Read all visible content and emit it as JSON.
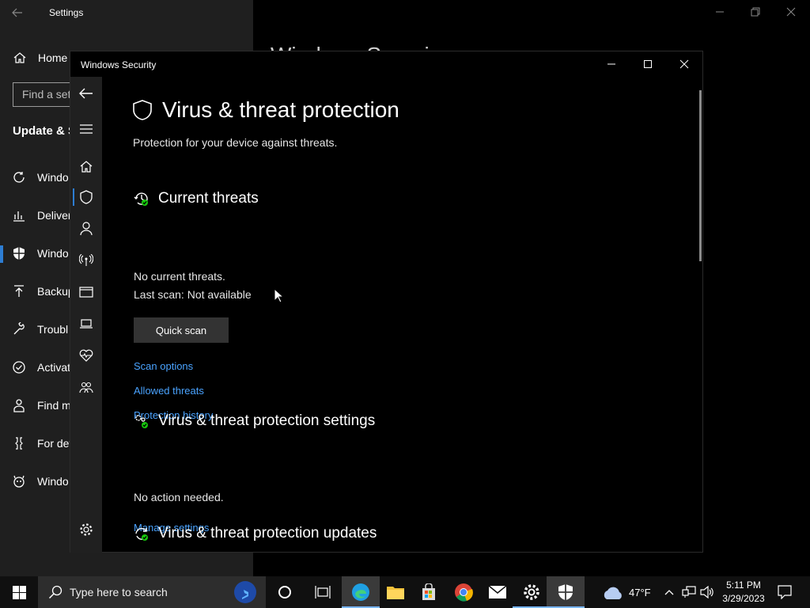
{
  "settings": {
    "title": "Settings",
    "home_label": "Home",
    "search_placeholder": "Find a set",
    "section_title": "Update & S",
    "bg_page_title": "Windows Securi",
    "items": [
      {
        "label": "Windo",
        "icon": "refresh-icon"
      },
      {
        "label": "Deliver",
        "icon": "delivery-icon"
      },
      {
        "label": "Windo",
        "icon": "shield-icon"
      },
      {
        "label": "Backup",
        "icon": "backup-icon"
      },
      {
        "label": "Troubl",
        "icon": "wrench-icon"
      },
      {
        "label": "Activat",
        "icon": "check-circle-icon"
      },
      {
        "label": "Find m",
        "icon": "person-icon"
      },
      {
        "label": "For dev",
        "icon": "developer-icon"
      },
      {
        "label": "Windo",
        "icon": "insider-icon"
      }
    ],
    "active_index": 2
  },
  "security": {
    "window_title": "Windows Security",
    "page_title": "Virus & threat protection",
    "page_subtitle": "Protection for your device against threats.",
    "current_threats": {
      "heading": "Current threats",
      "status": "No current threats.",
      "last_scan": "Last scan: Not available",
      "quick_scan_label": "Quick scan",
      "links": [
        "Scan options",
        "Allowed threats",
        "Protection history"
      ]
    },
    "settings_section": {
      "heading": "Virus & threat protection settings",
      "status": "No action needed.",
      "link": "Manage settings"
    },
    "updates_section": {
      "heading": "Virus & threat protection updates"
    }
  },
  "taskbar": {
    "search_placeholder": "Type here to search",
    "weather": "47°F",
    "time": "5:11 PM",
    "date": "3/29/2023"
  },
  "colors": {
    "accent": "#2d7dd2",
    "link": "#4aa3ff",
    "status_ok": "#16c60c"
  }
}
